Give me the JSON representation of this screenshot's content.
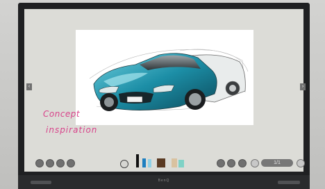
{
  "whiteboard": {
    "annotation_line1": "Concept",
    "annotation_line2": "inspiration",
    "ink_color": "#d8438a"
  },
  "toolbar": {
    "left_buttons": [
      "undo-icon",
      "redo-icon",
      "share-icon",
      "settings-icon"
    ],
    "tools": [
      "select-icon",
      "pen-icon",
      "marker-icon",
      "highlighter-icon",
      "eraser-icon",
      "shape-icon"
    ],
    "right_buttons": [
      "zoom-out-icon",
      "zoom-in-icon",
      "fit-icon",
      "add-page-icon"
    ],
    "page_indicator": "1/1"
  },
  "device": {
    "brand": "BenQ"
  }
}
